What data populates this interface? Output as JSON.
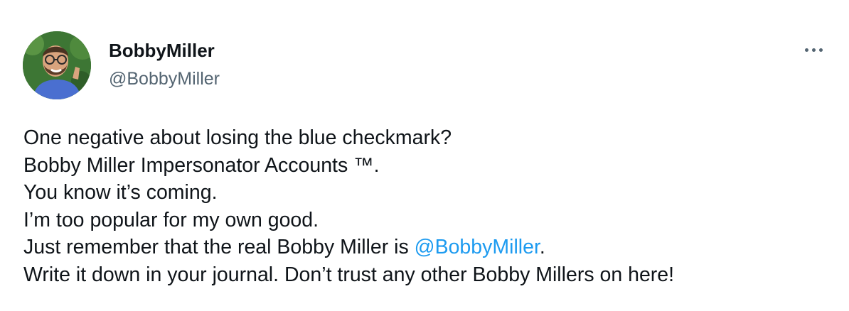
{
  "author": {
    "display_name": "BobbyMiller",
    "handle": "@BobbyMiller",
    "avatar_icon": "profile-photo"
  },
  "menu": {
    "icon": "more-options-icon"
  },
  "tweet": {
    "lines": [
      "One negative about losing the blue checkmark?",
      "Bobby Miller Impersonator Accounts ™.",
      "You know it’s coming.",
      "I’m too popular for my own good."
    ],
    "line5_prefix": "Just remember that the real Bobby Miller is ",
    "line5_mention": "@BobbyMiller",
    "line5_suffix": ".",
    "line6": "Write it down in your journal. Don’t trust any other Bobby Millers on here!"
  },
  "colors": {
    "text": "#0f1419",
    "secondary": "#536471",
    "link": "#1d9bf0"
  }
}
